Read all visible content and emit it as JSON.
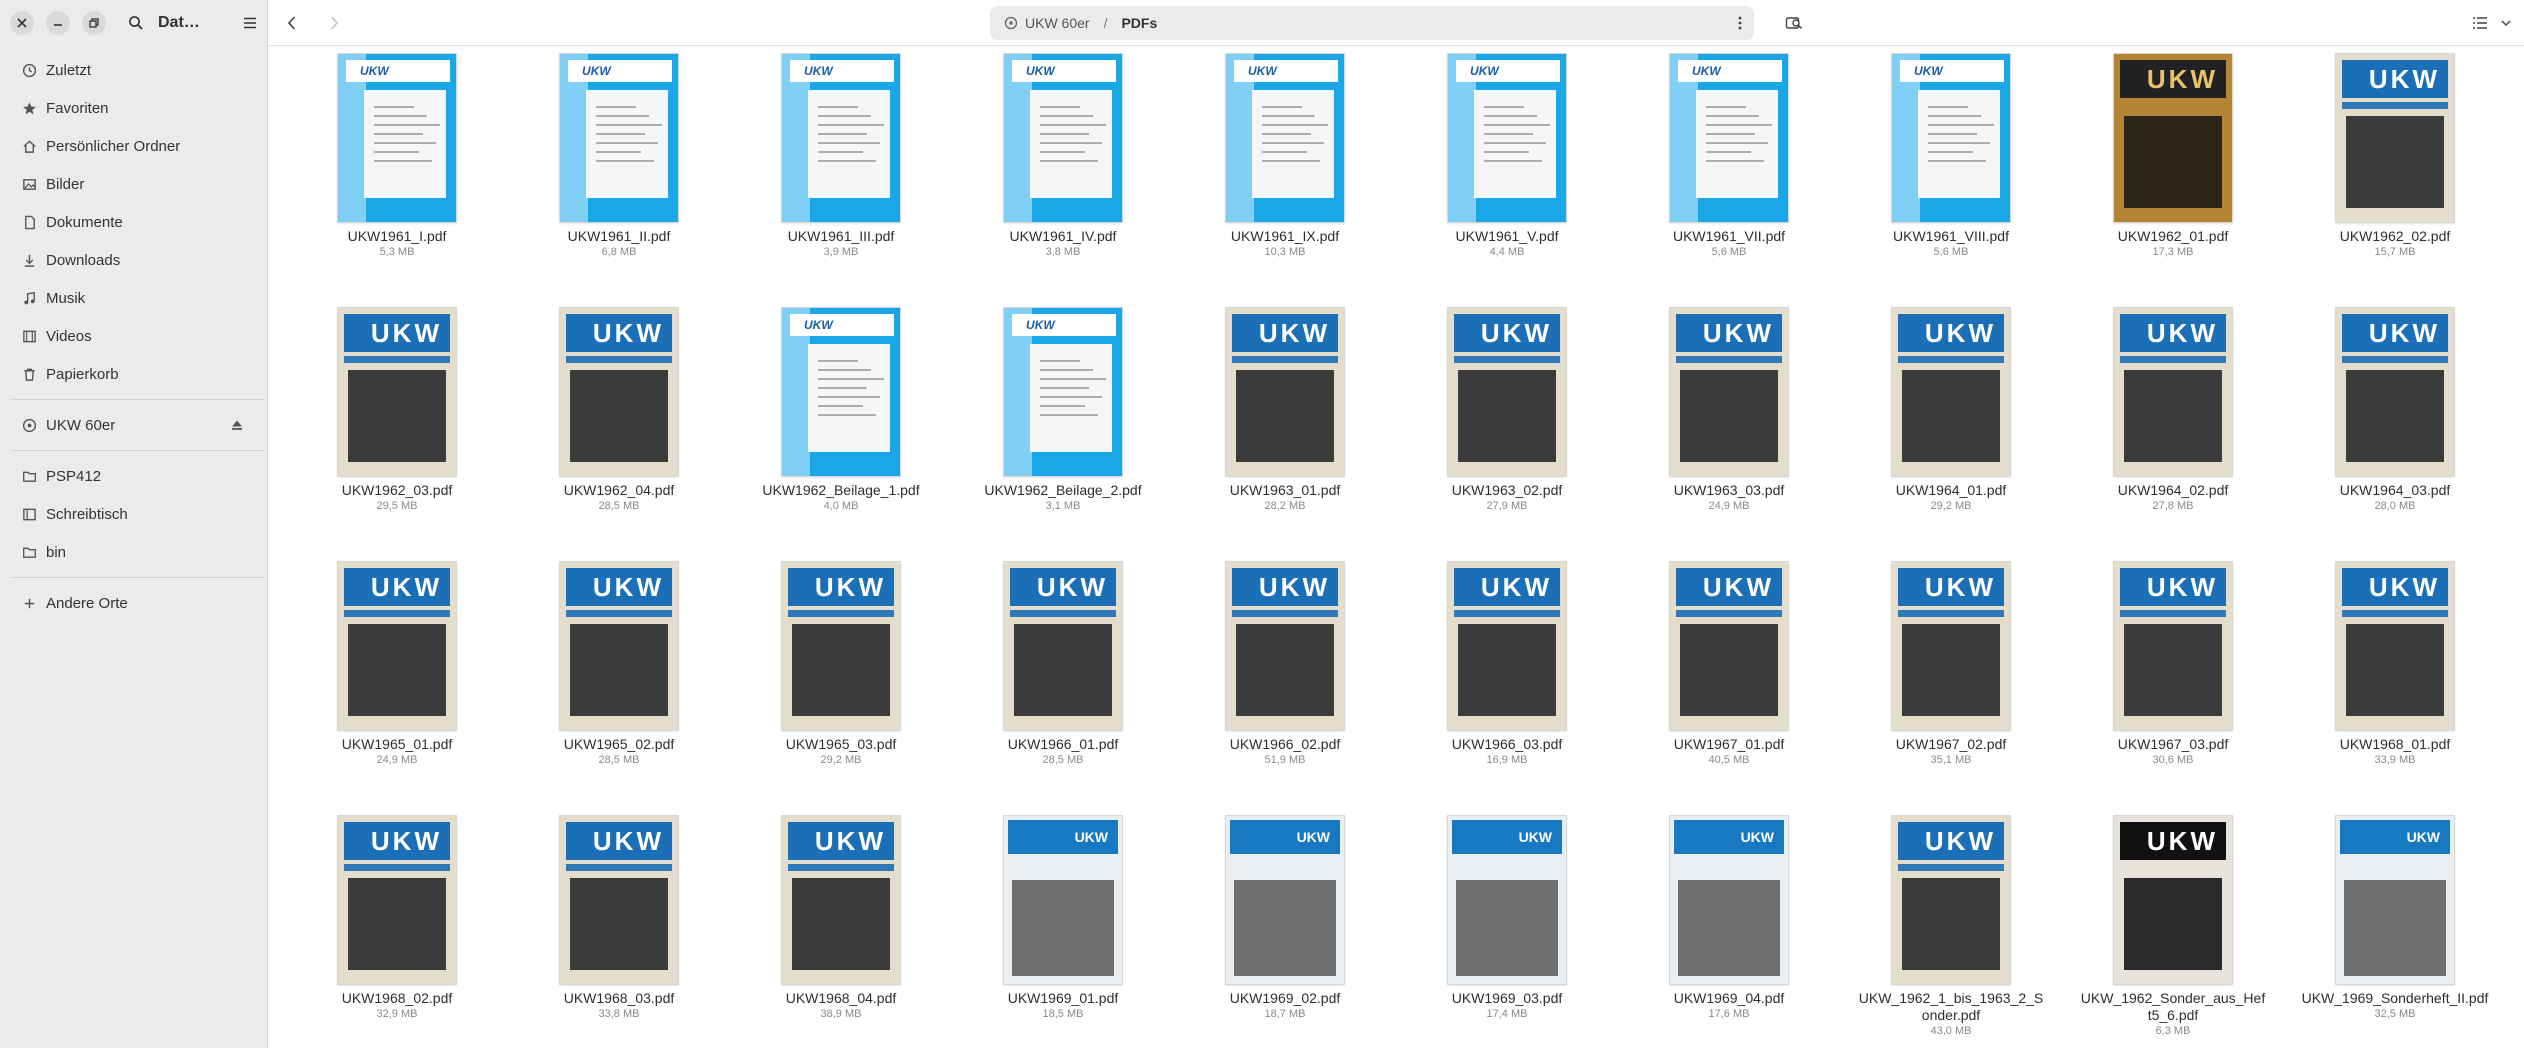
{
  "window": {
    "title": "Dat…",
    "location_parent": "UKW 60er",
    "location_current": "PDFs"
  },
  "sidebar": {
    "items": [
      {
        "label": "Zuletzt",
        "icon": "clock-icon"
      },
      {
        "label": "Favoriten",
        "icon": "star-icon"
      },
      {
        "label": "Persönlicher Ordner",
        "icon": "home-icon"
      },
      {
        "label": "Bilder",
        "icon": "image-icon"
      },
      {
        "label": "Dokumente",
        "icon": "document-icon"
      },
      {
        "label": "Downloads",
        "icon": "download-icon"
      },
      {
        "label": "Musik",
        "icon": "music-icon"
      },
      {
        "label": "Videos",
        "icon": "video-icon"
      },
      {
        "label": "Papierkorb",
        "icon": "trash-icon"
      }
    ],
    "devices": [
      {
        "label": "UKW 60er",
        "icon": "drive-icon"
      }
    ],
    "bookmarks": [
      {
        "label": "PSP412",
        "icon": "folder-icon"
      },
      {
        "label": "Schreibtisch",
        "icon": "desktop-icon"
      },
      {
        "label": "bin",
        "icon": "folder-icon"
      }
    ],
    "other": {
      "label": "Andere Orte",
      "icon": "plus-icon"
    }
  },
  "files": [
    {
      "name": "UKW1961_I.pdf",
      "size": "5,3 MB",
      "cover": "blue"
    },
    {
      "name": "UKW1961_II.pdf",
      "size": "6,8 MB",
      "cover": "blue"
    },
    {
      "name": "UKW1961_III.pdf",
      "size": "3,9 MB",
      "cover": "blue"
    },
    {
      "name": "UKW1961_IV.pdf",
      "size": "3,8 MB",
      "cover": "blue"
    },
    {
      "name": "UKW1961_IX.pdf",
      "size": "10,3 MB",
      "cover": "blue"
    },
    {
      "name": "UKW1961_V.pdf",
      "size": "4,4 MB",
      "cover": "blue"
    },
    {
      "name": "UKW1961_VII.pdf",
      "size": "5,6 MB",
      "cover": "blue"
    },
    {
      "name": "UKW1961_VIII.pdf",
      "size": "5,6 MB",
      "cover": "blue"
    },
    {
      "name": "UKW1962_01.pdf",
      "size": "17,3 MB",
      "cover": "gold"
    },
    {
      "name": "UKW1962_02.pdf",
      "size": "15,7 MB",
      "cover": "beige"
    },
    {
      "name": "UKW1962_03.pdf",
      "size": "29,5 MB",
      "cover": "beige"
    },
    {
      "name": "UKW1962_04.pdf",
      "size": "28,5 MB",
      "cover": "beige"
    },
    {
      "name": "UKW1962_Beilage_1.pdf",
      "size": "4,0 MB",
      "cover": "blue"
    },
    {
      "name": "UKW1962_Beilage_2.pdf",
      "size": "3,1 MB",
      "cover": "blue"
    },
    {
      "name": "UKW1963_01.pdf",
      "size": "28,2 MB",
      "cover": "beige"
    },
    {
      "name": "UKW1963_02.pdf",
      "size": "27,9 MB",
      "cover": "beige"
    },
    {
      "name": "UKW1963_03.pdf",
      "size": "24,9 MB",
      "cover": "beige"
    },
    {
      "name": "UKW1964_01.pdf",
      "size": "29,2 MB",
      "cover": "beige"
    },
    {
      "name": "UKW1964_02.pdf",
      "size": "27,8 MB",
      "cover": "beige"
    },
    {
      "name": "UKW1964_03.pdf",
      "size": "28,0 MB",
      "cover": "beige"
    },
    {
      "name": "UKW1965_01.pdf",
      "size": "24,9 MB",
      "cover": "beige"
    },
    {
      "name": "UKW1965_02.pdf",
      "size": "28,5 MB",
      "cover": "beige"
    },
    {
      "name": "UKW1965_03.pdf",
      "size": "29,2 MB",
      "cover": "beige"
    },
    {
      "name": "UKW1966_01.pdf",
      "size": "28,5 MB",
      "cover": "beige"
    },
    {
      "name": "UKW1966_02.pdf",
      "size": "51,9 MB",
      "cover": "beige"
    },
    {
      "name": "UKW1966_03.pdf",
      "size": "16,9 MB",
      "cover": "beige"
    },
    {
      "name": "UKW1967_01.pdf",
      "size": "40,5 MB",
      "cover": "beige"
    },
    {
      "name": "UKW1967_02.pdf",
      "size": "35,1 MB",
      "cover": "beige"
    },
    {
      "name": "UKW1967_03.pdf",
      "size": "30,6 MB",
      "cover": "beige"
    },
    {
      "name": "UKW1968_01.pdf",
      "size": "33,9 MB",
      "cover": "beige"
    },
    {
      "name": "UKW1968_02.pdf",
      "size": "32,9 MB",
      "cover": "beige"
    },
    {
      "name": "UKW1968_03.pdf",
      "size": "33,8 MB",
      "cover": "beige"
    },
    {
      "name": "UKW1968_04.pdf",
      "size": "38,9 MB",
      "cover": "beige"
    },
    {
      "name": "UKW1969_01.pdf",
      "size": "18,5 MB",
      "cover": "new"
    },
    {
      "name": "UKW1969_02.pdf",
      "size": "18,7 MB",
      "cover": "new"
    },
    {
      "name": "UKW1969_03.pdf",
      "size": "17,4 MB",
      "cover": "new"
    },
    {
      "name": "UKW1969_04.pdf",
      "size": "17,6 MB",
      "cover": "new"
    },
    {
      "name": "UKW_1962_1_bis_1963_2_Sonder.pdf",
      "size": "43,0 MB",
      "cover": "beige"
    },
    {
      "name": "UKW_1962_Sonder_aus_Heft5_6.pdf",
      "size": "6,3 MB",
      "cover": "black"
    },
    {
      "name": "UKW_1969_Sonderheft_II.pdf",
      "size": "32,5 MB",
      "cover": "new"
    }
  ],
  "colors": {
    "sidebar_bg": "#ebebeb",
    "cover_blue": "#1aa7e8",
    "cover_logo_blue": "#1a6fb6"
  }
}
